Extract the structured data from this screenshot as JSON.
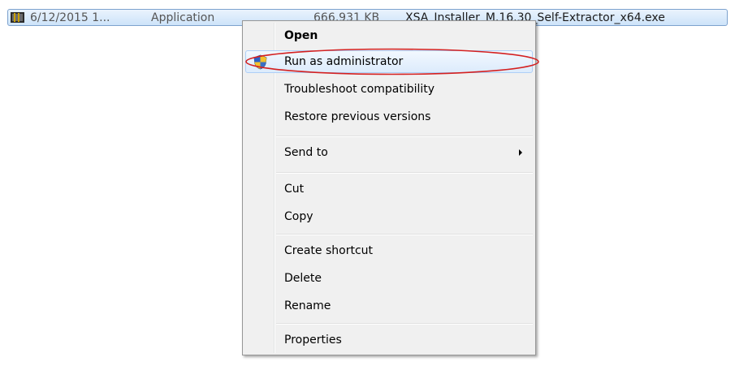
{
  "file_row": {
    "icon": "application-exe-icon",
    "date": "6/12/2015 1...",
    "type": "Application",
    "size": "666,931 KB",
    "name": "XSA_Installer_M.16.30_Self-Extractor_x64.exe"
  },
  "context_menu": {
    "items": [
      {
        "label": "Open",
        "bold": true
      },
      {
        "label": "Run as administrator",
        "icon": "uac-shield-icon",
        "highlighted": true
      },
      {
        "label": "Troubleshoot compatibility"
      },
      {
        "label": "Restore previous versions"
      },
      {
        "label": "Send to",
        "submenu": true
      },
      {
        "label": "Cut"
      },
      {
        "label": "Copy"
      },
      {
        "label": "Create shortcut"
      },
      {
        "label": "Delete"
      },
      {
        "label": "Rename"
      },
      {
        "label": "Properties"
      }
    ]
  },
  "annotation": {
    "target": "Run as administrator",
    "color": "#d42020"
  }
}
